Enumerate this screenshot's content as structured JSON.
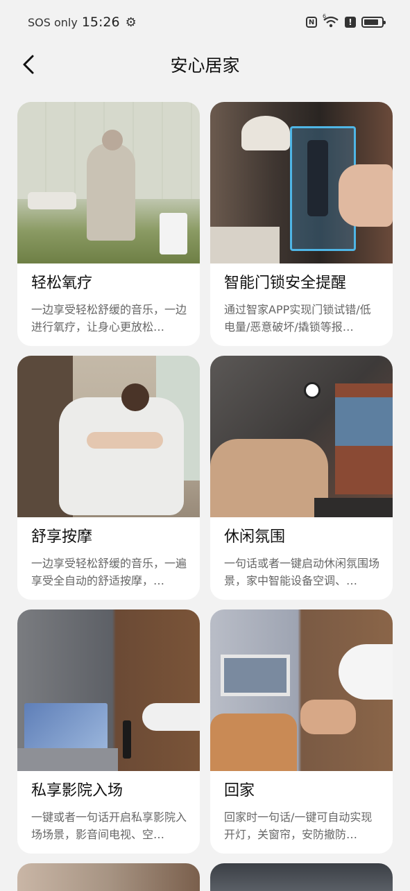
{
  "status_bar": {
    "carrier": "SOS only",
    "time": "15:26",
    "battery_level": 0.85,
    "wifi_badge": "6"
  },
  "header": {
    "title": "安心居家",
    "back_icon": "back-arrow-icon"
  },
  "cards": [
    {
      "title": "轻松氧疗",
      "desc": "一边享受轻松舒缓的音乐，一边进行氧疗，让身心更放松…"
    },
    {
      "title": "智能门锁安全提醒",
      "desc": "通过智家APP实现门锁试错/低电量/恶意破坏/撬锁等报…"
    },
    {
      "title": "舒享按摩",
      "desc": "一边享受轻松舒缓的音乐，一遍享受全自动的舒适按摩，…"
    },
    {
      "title": "休闲氛围",
      "desc": "一句话或者一键启动休闲氛围场景，家中智能设备空调、…"
    },
    {
      "title": "私享影院入场",
      "desc": "一键或者一句话开启私享影院入场场景，影音间电视、空…"
    },
    {
      "title": "回家",
      "desc": "回家时一句话/一键可自动实现开灯，关窗帘，安防撤防…"
    }
  ]
}
